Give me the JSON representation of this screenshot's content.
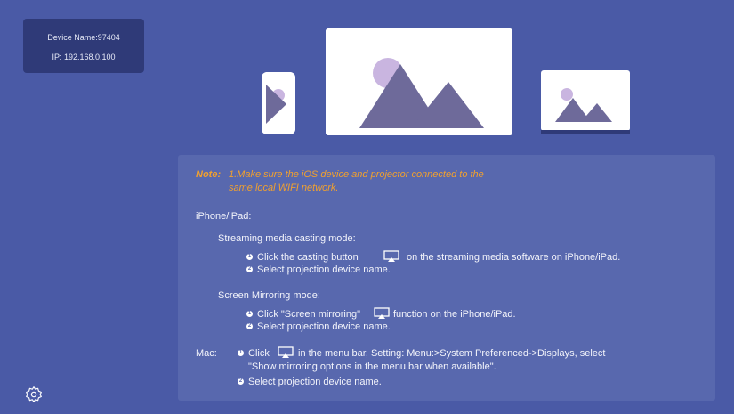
{
  "device": {
    "name_line": "Device Name:97404",
    "ip_line": "IP: 192.168.0.100"
  },
  "note": {
    "label": "Note:",
    "line1": "1.Make sure the iOS device and projector connected to the",
    "line2": "same local WIFI network."
  },
  "iphone": {
    "heading": "iPhone/iPad:",
    "streaming": {
      "title": "Streaming media casting mode:",
      "step1_pre": "Click the casting button",
      "step1_post": "on the streaming media software on iPhone/iPad.",
      "step2": "Select projection device name."
    },
    "mirroring": {
      "title": "Screen Mirroring mode:",
      "step1_pre": "Click \"Screen mirroring\"",
      "step1_post": "function on the iPhone/iPad.",
      "step2": "Select projection device name."
    }
  },
  "mac": {
    "label": "Mac:",
    "step1_pre": "Click",
    "step1_post": "in the menu bar, Setting: Menu:>System Preferenced->Displays, select",
    "step1_line2": "\"Show mirroring options in the menu bar when available\".",
    "step2": "Select projection device name."
  },
  "icons": {
    "cast": "airplay-cast-icon",
    "settings": "gear-icon"
  },
  "colors": {
    "background": "#4a5aa6",
    "panel": "#5868ae",
    "device_box": "#2f3a78",
    "note": "#f2a12e",
    "illustration": "#6e6a9a",
    "sun": "#c9b5e0"
  }
}
